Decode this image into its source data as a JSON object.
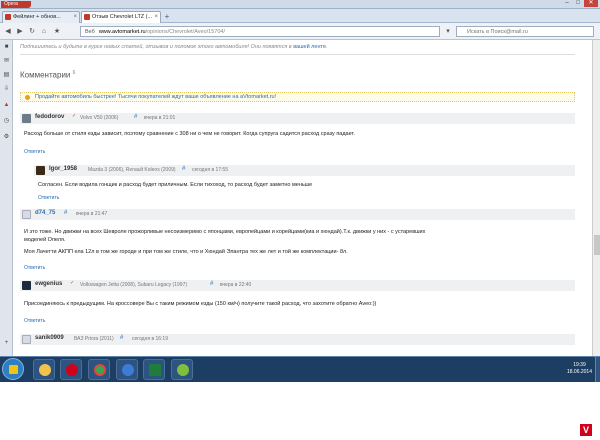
{
  "browser": {
    "menu_label": "Opera",
    "tabs": [
      {
        "label": "Фейлинг + обнов..."
      },
      {
        "label": "Отзыв Chevrolet LTZ (..."
      }
    ],
    "address": {
      "label": "Веб",
      "host": "www.avtomarket.ru",
      "path": "/opinions/Chevrolet/Aveo/15704/"
    },
    "search_placeholder": "Искать в Поиск@mail.ru"
  },
  "page": {
    "subscribe_text": "Подпишитесь и будьте в курсе новых статей, отзывов и поломок этого автомобиля! Они появятся в",
    "subscribe_link": "вашей ленте",
    "comments_title": "Комментарии",
    "comments_count": "6",
    "promo_text": "Продайте автомобиль быстрее! Тысячи покупателей ждут ваше объявление на aVtomarket.ru!"
  },
  "comments": [
    {
      "user": "fedodorov",
      "cars": "Volvo V50 (2006)",
      "time": "вчера в 21:01",
      "text": [
        "Расход больше от стиля езды зависит, поэтому сравнение с 308 ни о чем не говорит. Когда супруга садится расход сразу падает."
      ],
      "reply": "Ответить"
    },
    {
      "user": "Igor_1958",
      "cars": "Mazda 3 (2006), Renault Koleos (2009)",
      "time": "сегодня в 17:55",
      "text": [
        "Согласен. Если водила гонщик и расход будет приличным. Если тихоход, то расход будет заметно меньше"
      ],
      "reply": "Ответить"
    },
    {
      "user": "d74_75",
      "cars": "",
      "time": "вчера в 21:47",
      "text": [
        "И это тоже. Но движки на всех Шевроле прожорливые несоизмеримо с японцами, европейцами и корейцами(киа и хюндай).Т.к. движки у них - с устаревших",
        "моделей Опеля.",
        "Моя Лачетти АКПП ела 12л в том же городе и при том же стиле, что и Хюндай Элантра тех же лет и той же комплектации- 8л."
      ],
      "reply": "Ответить"
    },
    {
      "user": "ewgenius",
      "cars": "Volkswagen Jetta (2008), Subaru Legacy (1997)",
      "time": "вчера в 22:40",
      "text": [
        "Присоединяюсь к предыдущим. На кроссовере Вы с таким режимом езды (150 км/ч) получите такой расход, что захотите обратно Aveo:))"
      ],
      "reply": "Ответить"
    },
    {
      "user": "sanik0909",
      "cars": "ВАЗ Priora (2011)",
      "time": "сегодня в 16:19",
      "text": [],
      "reply": ""
    }
  ],
  "taskbar": {
    "time": "19:39",
    "date": "18.06.2014"
  },
  "colors": {
    "link": "#2a6bb3",
    "accent": "#c0392b",
    "taskbar": "#1c3e62"
  }
}
